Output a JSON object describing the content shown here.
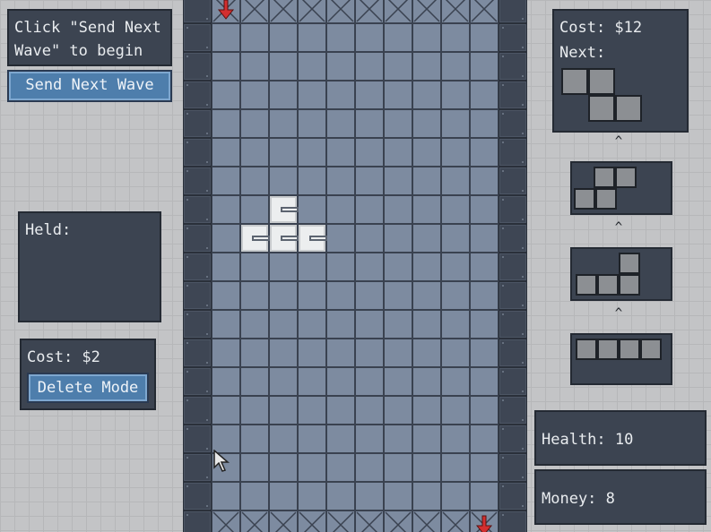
{
  "wave": {
    "hint": [
      "Click \"Send Next",
      "Wave\" to begin"
    ],
    "send_button": "Send Next Wave"
  },
  "held": {
    "label": "Held:"
  },
  "delete": {
    "cost": "Cost: $2",
    "button": "Delete Mode"
  },
  "shop": {
    "cost": "Cost: $12",
    "next_label": "Next:"
  },
  "stats": {
    "health": "Health: 10",
    "money": "Money: 8"
  },
  "queue_caret": "^",
  "colors": {
    "panel": "#3c4451",
    "button": "#4e7eac",
    "floor": "#7d8ba0",
    "wall": "#3e4654",
    "arrow": "#d32f2f",
    "tower": "#eceeef",
    "block": "#8c8f93"
  },
  "board": {
    "cols": 12,
    "rows": 19,
    "towers": [
      {
        "col": 3,
        "row": 7,
        "facing": "right"
      },
      {
        "col": 2,
        "row": 8,
        "facing": "right"
      },
      {
        "col": 3,
        "row": 8,
        "facing": "right"
      },
      {
        "col": 4,
        "row": 8,
        "facing": "right"
      }
    ],
    "entry_marker": {
      "col": 1,
      "row": 0,
      "icon": "arrow-down-icon"
    },
    "exit_marker": {
      "col": 10,
      "row": 18,
      "icon": "arrow-down-icon"
    }
  }
}
